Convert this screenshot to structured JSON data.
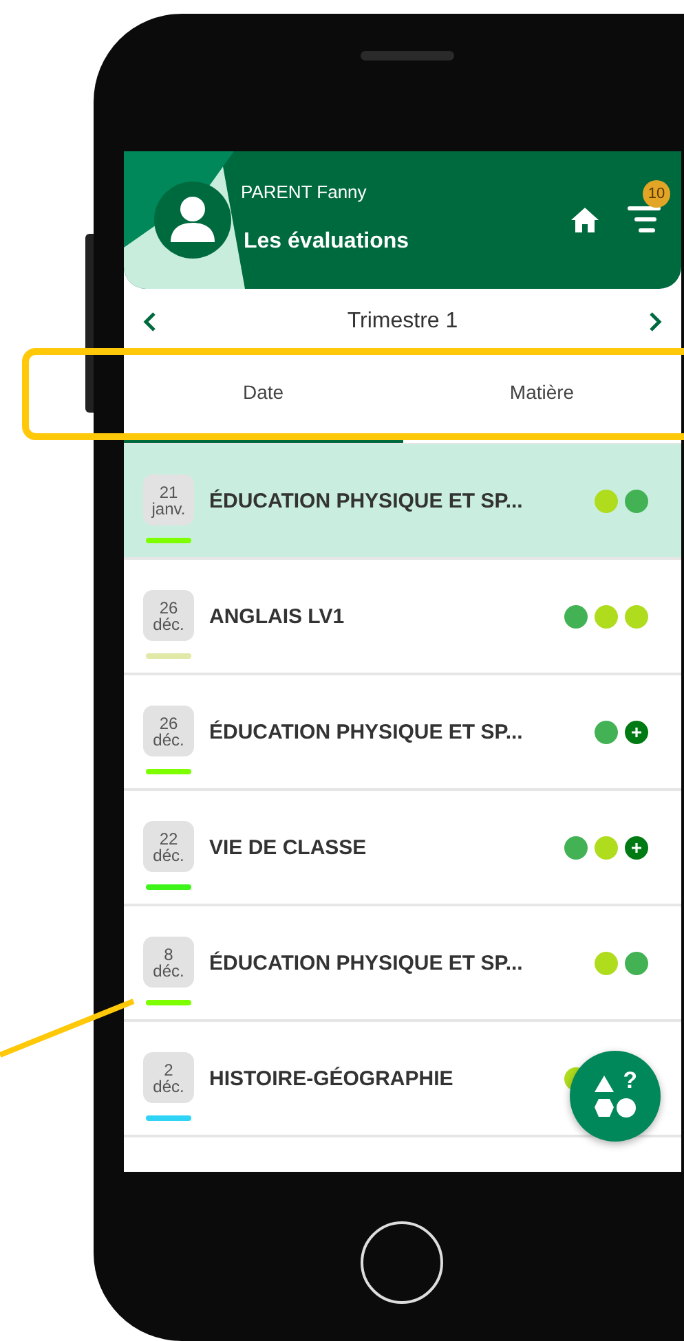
{
  "header": {
    "user": "PARENT Fanny",
    "title": "Les évaluations",
    "badge": "10"
  },
  "period": {
    "label": "Trimestre 1"
  },
  "tabs": [
    {
      "label": "Date",
      "selected": true
    },
    {
      "label": "Matière",
      "selected": false
    }
  ],
  "rows": [
    {
      "day": "21",
      "month": "janv.",
      "subject": "ÉDUCATION PHYSIQUE ET SP...",
      "selected": true,
      "color": "#7dff00",
      "marks": [
        {
          "kind": "dot",
          "color": "#b0dc1e"
        },
        {
          "kind": "dot",
          "color": "#43b254"
        }
      ]
    },
    {
      "day": "26",
      "month": "déc.",
      "subject": "ANGLAIS LV1",
      "selected": false,
      "color": "#e2e8a6",
      "marks": [
        {
          "kind": "dot",
          "color": "#43b254"
        },
        {
          "kind": "dot",
          "color": "#b0dc1e"
        },
        {
          "kind": "dot",
          "color": "#b0dc1e"
        }
      ]
    },
    {
      "day": "26",
      "month": "déc.",
      "subject": "ÉDUCATION PHYSIQUE ET SP...",
      "selected": false,
      "color": "#7dff00",
      "marks": [
        {
          "kind": "dot",
          "color": "#43b254"
        },
        {
          "kind": "plus",
          "color": "#007a12"
        }
      ]
    },
    {
      "day": "22",
      "month": "déc.",
      "subject": "VIE DE CLASSE",
      "selected": false,
      "color": "#3ef51a",
      "marks": [
        {
          "kind": "dot",
          "color": "#43b254"
        },
        {
          "kind": "dot",
          "color": "#b0dc1e"
        },
        {
          "kind": "plus",
          "color": "#007a12"
        }
      ]
    },
    {
      "day": "8",
      "month": "déc.",
      "subject": "ÉDUCATION PHYSIQUE ET SP...",
      "selected": false,
      "color": "#7dff00",
      "marks": [
        {
          "kind": "dot",
          "color": "#b0dc1e"
        },
        {
          "kind": "dot",
          "color": "#43b254"
        }
      ]
    },
    {
      "day": "2",
      "month": "déc.",
      "subject": "HISTOIRE-GÉOGRAPHIE",
      "selected": false,
      "color": "#2ed3f5",
      "marks": [
        {
          "kind": "dot",
          "color": "#b0dc1e"
        }
      ]
    }
  ],
  "fab": {
    "symbol": "?"
  }
}
